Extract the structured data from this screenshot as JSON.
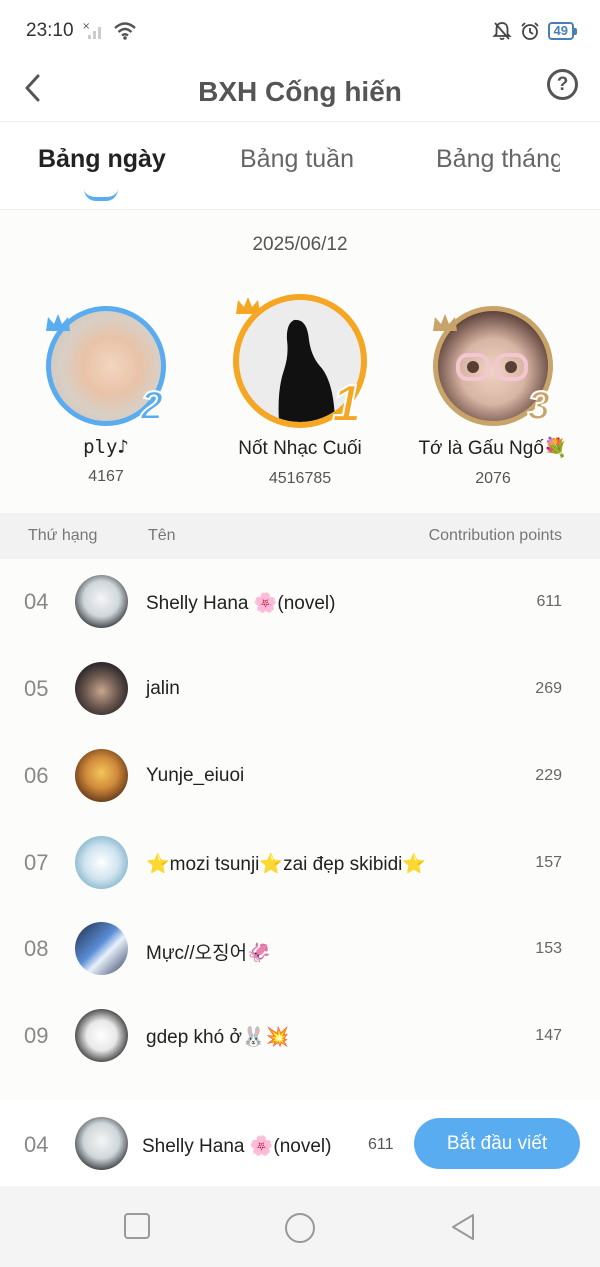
{
  "status_bar": {
    "time": "23:10",
    "battery": "49",
    "icons": [
      "no-signal-icon",
      "wifi-icon",
      "bell-muted-icon",
      "alarm-icon",
      "battery-icon"
    ]
  },
  "header": {
    "title": "BXH Cống hiến",
    "back_icon": "chevron-left-icon",
    "help_label": "?"
  },
  "tabs": [
    {
      "label": "Bảng ngày",
      "active": true
    },
    {
      "label": "Bảng tuần",
      "active": false
    },
    {
      "label": "Bảng tháng",
      "active": false
    }
  ],
  "date": "2025/06/12",
  "podium": [
    {
      "rank": "2",
      "name": "ply♪",
      "score": "4167",
      "ring_color": "#5aacf0"
    },
    {
      "rank": "1",
      "name": "Nốt Nhạc Cuối",
      "score": "4516785",
      "ring_color": "#f5a623"
    },
    {
      "rank": "3",
      "name": "Tớ là Gấu Ngố💐",
      "score": "2076",
      "ring_color": "#c8a46a"
    }
  ],
  "table": {
    "col_rank": "Thứ hạng",
    "col_name": "Tên",
    "col_points": "Contribution points",
    "rows": [
      {
        "rank": "04",
        "name": "Shelly Hana 🌸(novel)",
        "points": "611"
      },
      {
        "rank": "05",
        "name": "jalin",
        "points": "269"
      },
      {
        "rank": "06",
        "name": "Yunje_eiuoi",
        "points": "229"
      },
      {
        "rank": "07",
        "name": "⭐mozi tsunji⭐zai đẹp skibidi⭐",
        "points": "157"
      },
      {
        "rank": "08",
        "name": "Mực//오징어🦑",
        "points": "153"
      },
      {
        "rank": "09",
        "name": "gdep khó ở🐰💥",
        "points": "147"
      }
    ]
  },
  "my_rank": {
    "rank": "04",
    "name": "Shelly Hana 🌸(novel)",
    "points": "611"
  },
  "start_button": "Bắt đầu viết",
  "colors": {
    "accent": "#5aacf0",
    "gold": "#f5a623",
    "bronze": "#c8a46a"
  }
}
